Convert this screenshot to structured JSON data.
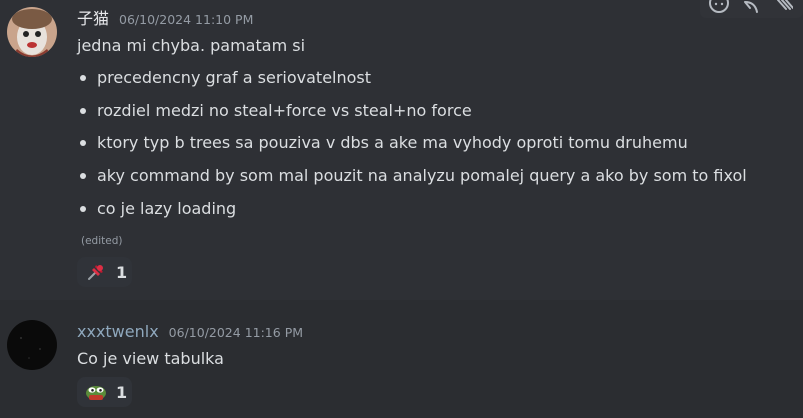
{
  "messages": [
    {
      "username": "子猫",
      "timestamp": "06/10/2024 11:10 PM",
      "text": "jedna mi chyba. pamatam si",
      "bullets": [
        "precedencny graf a seriovatelnost",
        "rozdiel medzi no steal+force vs steal+no force",
        "ktory typ b trees sa pouziva v dbs a ake ma vyhody oproti tomu druhemu",
        "aky command by som mal pouzit na analyzu pomalej query a ako by som to fixol",
        "co je lazy loading"
      ],
      "edited_label": "(edited)",
      "reaction": {
        "emoji": "pushpin-emoji",
        "count": "1"
      }
    },
    {
      "username": "xxxtwenlx",
      "timestamp": "06/10/2024 11:16 PM",
      "text": "Co je view tabulka",
      "reaction": {
        "emoji": "pepe-frog-emoji",
        "count": "1"
      }
    }
  ],
  "toolbar_icons": [
    "add-reaction-icon",
    "reply-icon",
    "more-icon"
  ],
  "colors": {
    "background": "#2b2d31",
    "hover_background": "#2e3035",
    "username2": "#8fa8bd",
    "timestamp": "#949ba4"
  }
}
